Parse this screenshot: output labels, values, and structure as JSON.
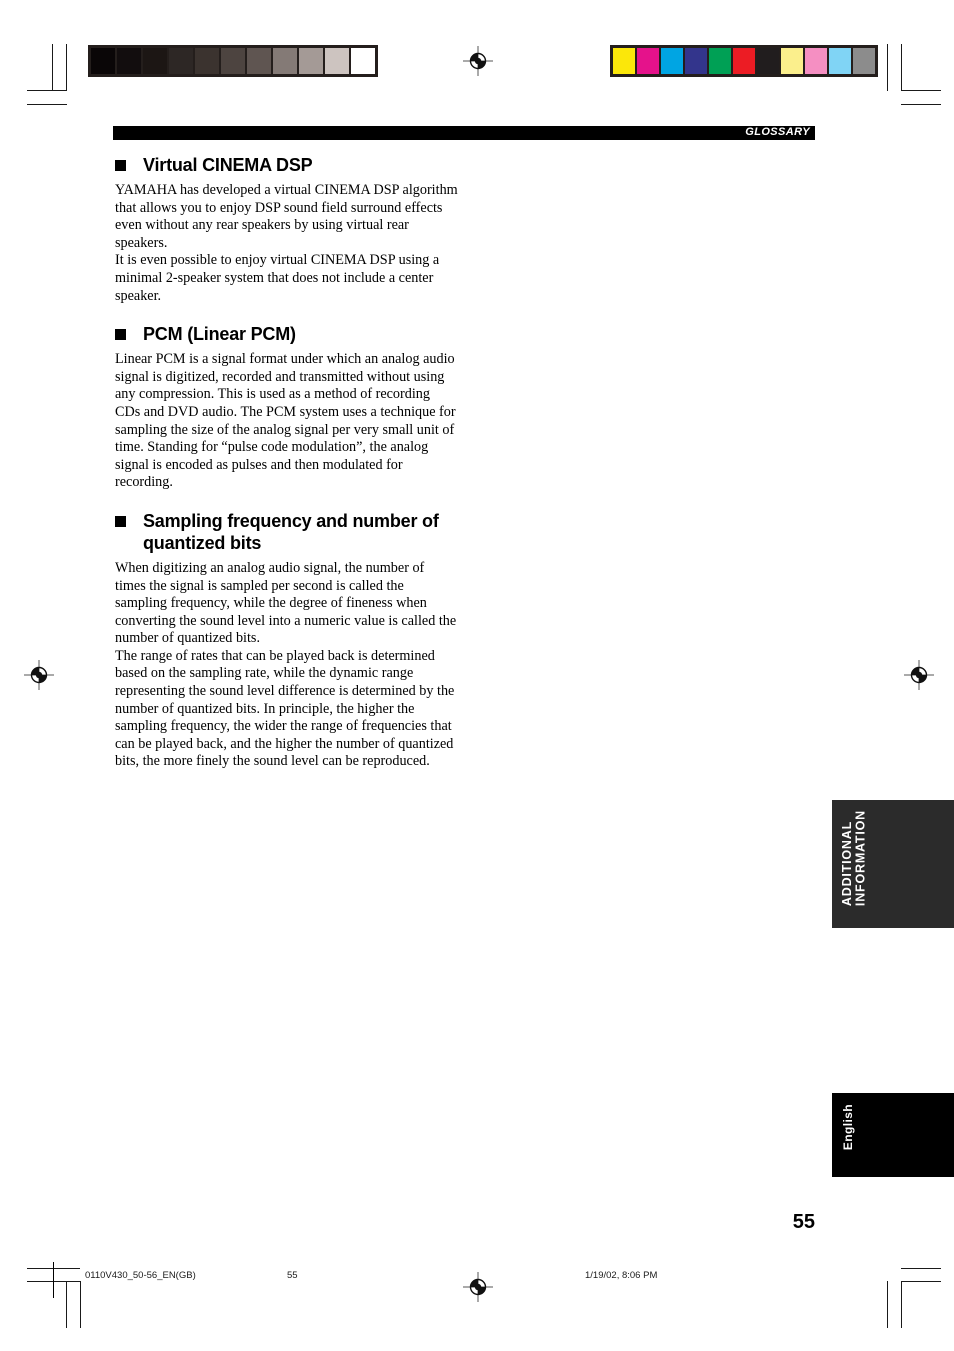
{
  "header": {
    "label": "GLOSSARY"
  },
  "sections": [
    {
      "heading": "Virtual CINEMA DSP",
      "bullet_icon": "filled-square-bullet-icon",
      "paragraphs": [
        "YAMAHA has developed a virtual CINEMA DSP algorithm that allows you to enjoy DSP sound field surround effects even without any rear speakers by using virtual rear speakers.",
        "It is even possible to enjoy virtual CINEMA DSP using a minimal 2-speaker system that does not include a center speaker."
      ]
    },
    {
      "heading": "PCM (Linear PCM)",
      "bullet_icon": "filled-square-bullet-icon",
      "paragraphs": [
        "Linear PCM is a signal format under which an analog audio signal is digitized, recorded and transmitted without using any compression. This is used as a method of recording CDs and DVD audio. The PCM system uses a technique for sampling the size of the analog signal per very small unit of time. Standing for “pulse code modulation”, the analog signal is encoded as pulses and then modulated for recording."
      ]
    },
    {
      "heading": "Sampling frequency and number of quantized bits",
      "bullet_icon": "filled-square-bullet-icon",
      "paragraphs": [
        "When digitizing an analog audio signal, the number of times the signal is sampled per second is called the sampling frequency, while the degree of fineness when converting the sound level into a numeric value is called the number of quantized bits.",
        "The range of rates that can be played back is determined based on the sampling rate, while the dynamic range representing the sound level difference is determined by the number of quantized bits. In principle, the higher the sampling frequency, the wider the range of frequencies that can be played back, and the higher the number of quantized bits, the more finely the sound level can be reproduced."
      ]
    }
  ],
  "side_tabs": [
    {
      "label": "ADDITIONAL\nINFORMATION",
      "background": "#2b2b2b"
    },
    {
      "label": "English",
      "background": "#000000"
    }
  ],
  "page_number": "55",
  "footer": {
    "file_name": "0110V430_50-56_EN(GB)",
    "page": "55",
    "timestamp": "1/19/02, 8:06 PM"
  },
  "print_marks": {
    "grayscale_wedge": {
      "name": "grayscale-calibration-strip",
      "patches": [
        "#0a0607",
        "#120d0e",
        "#1c1614",
        "#2d2725",
        "#3b332f",
        "#4d4440",
        "#5f5551",
        "#847a76",
        "#a49a96",
        "#cdc4c0",
        "#ffffff"
      ]
    },
    "color_bar": {
      "name": "color-calibration-strip",
      "patches": [
        "#fbe70a",
        "#e5128b",
        "#00a5e3",
        "#33358c",
        "#00a055",
        "#ec1c24",
        "#211d1e",
        "#fbef8c",
        "#f58fc2",
        "#80d4f5",
        "#8c8c8c"
      ]
    },
    "registration_target": "registration-target-icon",
    "crop_mark": "crop-mark"
  }
}
